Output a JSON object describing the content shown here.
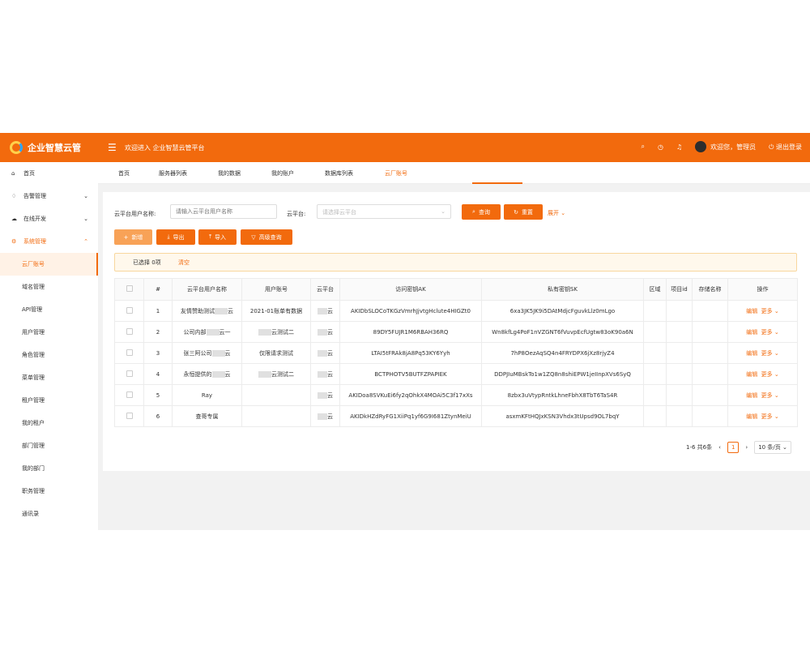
{
  "header": {
    "app_name": "企业智慧云管",
    "welcome": "欢迎进入 企业智慧云管平台",
    "user": "欢迎您，管理员",
    "logout": "退出登录"
  },
  "sidebar": {
    "items": [
      {
        "label": "首页",
        "icon": "home-icon"
      },
      {
        "label": "告警管理",
        "icon": "bell-icon",
        "chevron": "⌄"
      },
      {
        "label": "在线开发",
        "icon": "cloud-icon",
        "chevron": "⌄"
      },
      {
        "label": "系统管理",
        "icon": "gear-icon",
        "chevron": "⌃"
      },
      {
        "label": "云厂账号"
      },
      {
        "label": "域名管理"
      },
      {
        "label": "API管理"
      },
      {
        "label": "用户管理"
      },
      {
        "label": "角色管理"
      },
      {
        "label": "菜单管理"
      },
      {
        "label": "租户管理"
      },
      {
        "label": "我的租户"
      },
      {
        "label": "部门管理"
      },
      {
        "label": "我的部门"
      },
      {
        "label": "职务管理"
      },
      {
        "label": "通讯录"
      }
    ]
  },
  "tabs": [
    "首页",
    "服务器列表",
    "我的数据",
    "我的账户",
    "数据库列表",
    "云厂账号"
  ],
  "search": {
    "name_label": "云平台用户名称:",
    "name_placeholder": "请输入云平台用户名称",
    "platform_label": "云平台:",
    "platform_placeholder": "请选择云平台",
    "query": "查询",
    "reset": "重置",
    "expand": "展开"
  },
  "actions": {
    "add": "新增",
    "export": "导出",
    "import": "导入",
    "advanced": "高级查询"
  },
  "selection": {
    "text": "已选择 0项",
    "clear": "清空"
  },
  "table": {
    "headers": [
      "#",
      "云平台用户名称",
      "用户账号",
      "云平台",
      "访问密钥AK",
      "私有密钥SK",
      "区域",
      "项目id",
      "存储名称",
      "操作"
    ],
    "rows": [
      {
        "no": "1",
        "name": "友情赞助测试",
        "name_suffix": "云",
        "account": "2021-01账单有数据",
        "platform": "云",
        "ak": "AKIDbSLOCoTKGzVmrhJjvtgHclute4HIGZt0",
        "sk": "6xa3JK5JK9i5DAtMdjcFguvkLlz0mLgo",
        "edit": "编辑",
        "more": "更多"
      },
      {
        "no": "2",
        "name": "公司内部",
        "name_suffix": "云一",
        "account": "云测试二",
        "platform": "云",
        "ak": "89DY5FUJR1M6RBAH36RQ",
        "sk": "Wn8kfLg4PoF1nVZGNT6fVuvpEcfUgtw83oK90a6N",
        "edit": "编辑",
        "more": "更多"
      },
      {
        "no": "3",
        "name": "张三阿公司",
        "name_suffix": "云",
        "account": "仅限请求测试",
        "platform": "云",
        "ak": "LTAI5tFRAk8jA8Pq53KY6Yyh",
        "sk": "7hP8OezAqSQ4n4FRYDPX6jXz8rjyZ4",
        "edit": "编辑",
        "more": "更多"
      },
      {
        "no": "4",
        "name": "永恒提供的",
        "name_suffix": "云",
        "account": "云测试二",
        "platform": "云",
        "ak": "BCTPHOTV5BUTFZPAPIEK",
        "sk": "DDPJIuMBskTo1w1ZQ8n8shiEPW1jeIInpXVs6SyQ",
        "edit": "编辑",
        "more": "更多"
      },
      {
        "no": "5",
        "name": "Ray",
        "name_suffix": "",
        "account": "",
        "platform": "云",
        "ak": "AKIDoa8SVKuEi6fy2qOhkX4MOAi5C3f17xXs",
        "sk": "8zbx3uVtypRntkLhneFbhX8TbT6TaS4R",
        "edit": "编辑",
        "more": "更多"
      },
      {
        "no": "6",
        "name": "查哥专属",
        "name_suffix": "",
        "account": "",
        "platform": "云",
        "ak": "AKIDkHZdRyFG1XiiPq1yf6G9I681ZtynMeiU",
        "sk": "asxmKFtHQJxKSN3Vhdx3tUpsd9OL7bqY",
        "edit": "编辑",
        "more": "更多"
      }
    ]
  },
  "pagination": {
    "total": "1-6 共6条",
    "page": "1",
    "size": "10 条/页"
  },
  "colors": {
    "accent": "#f26a0d"
  }
}
